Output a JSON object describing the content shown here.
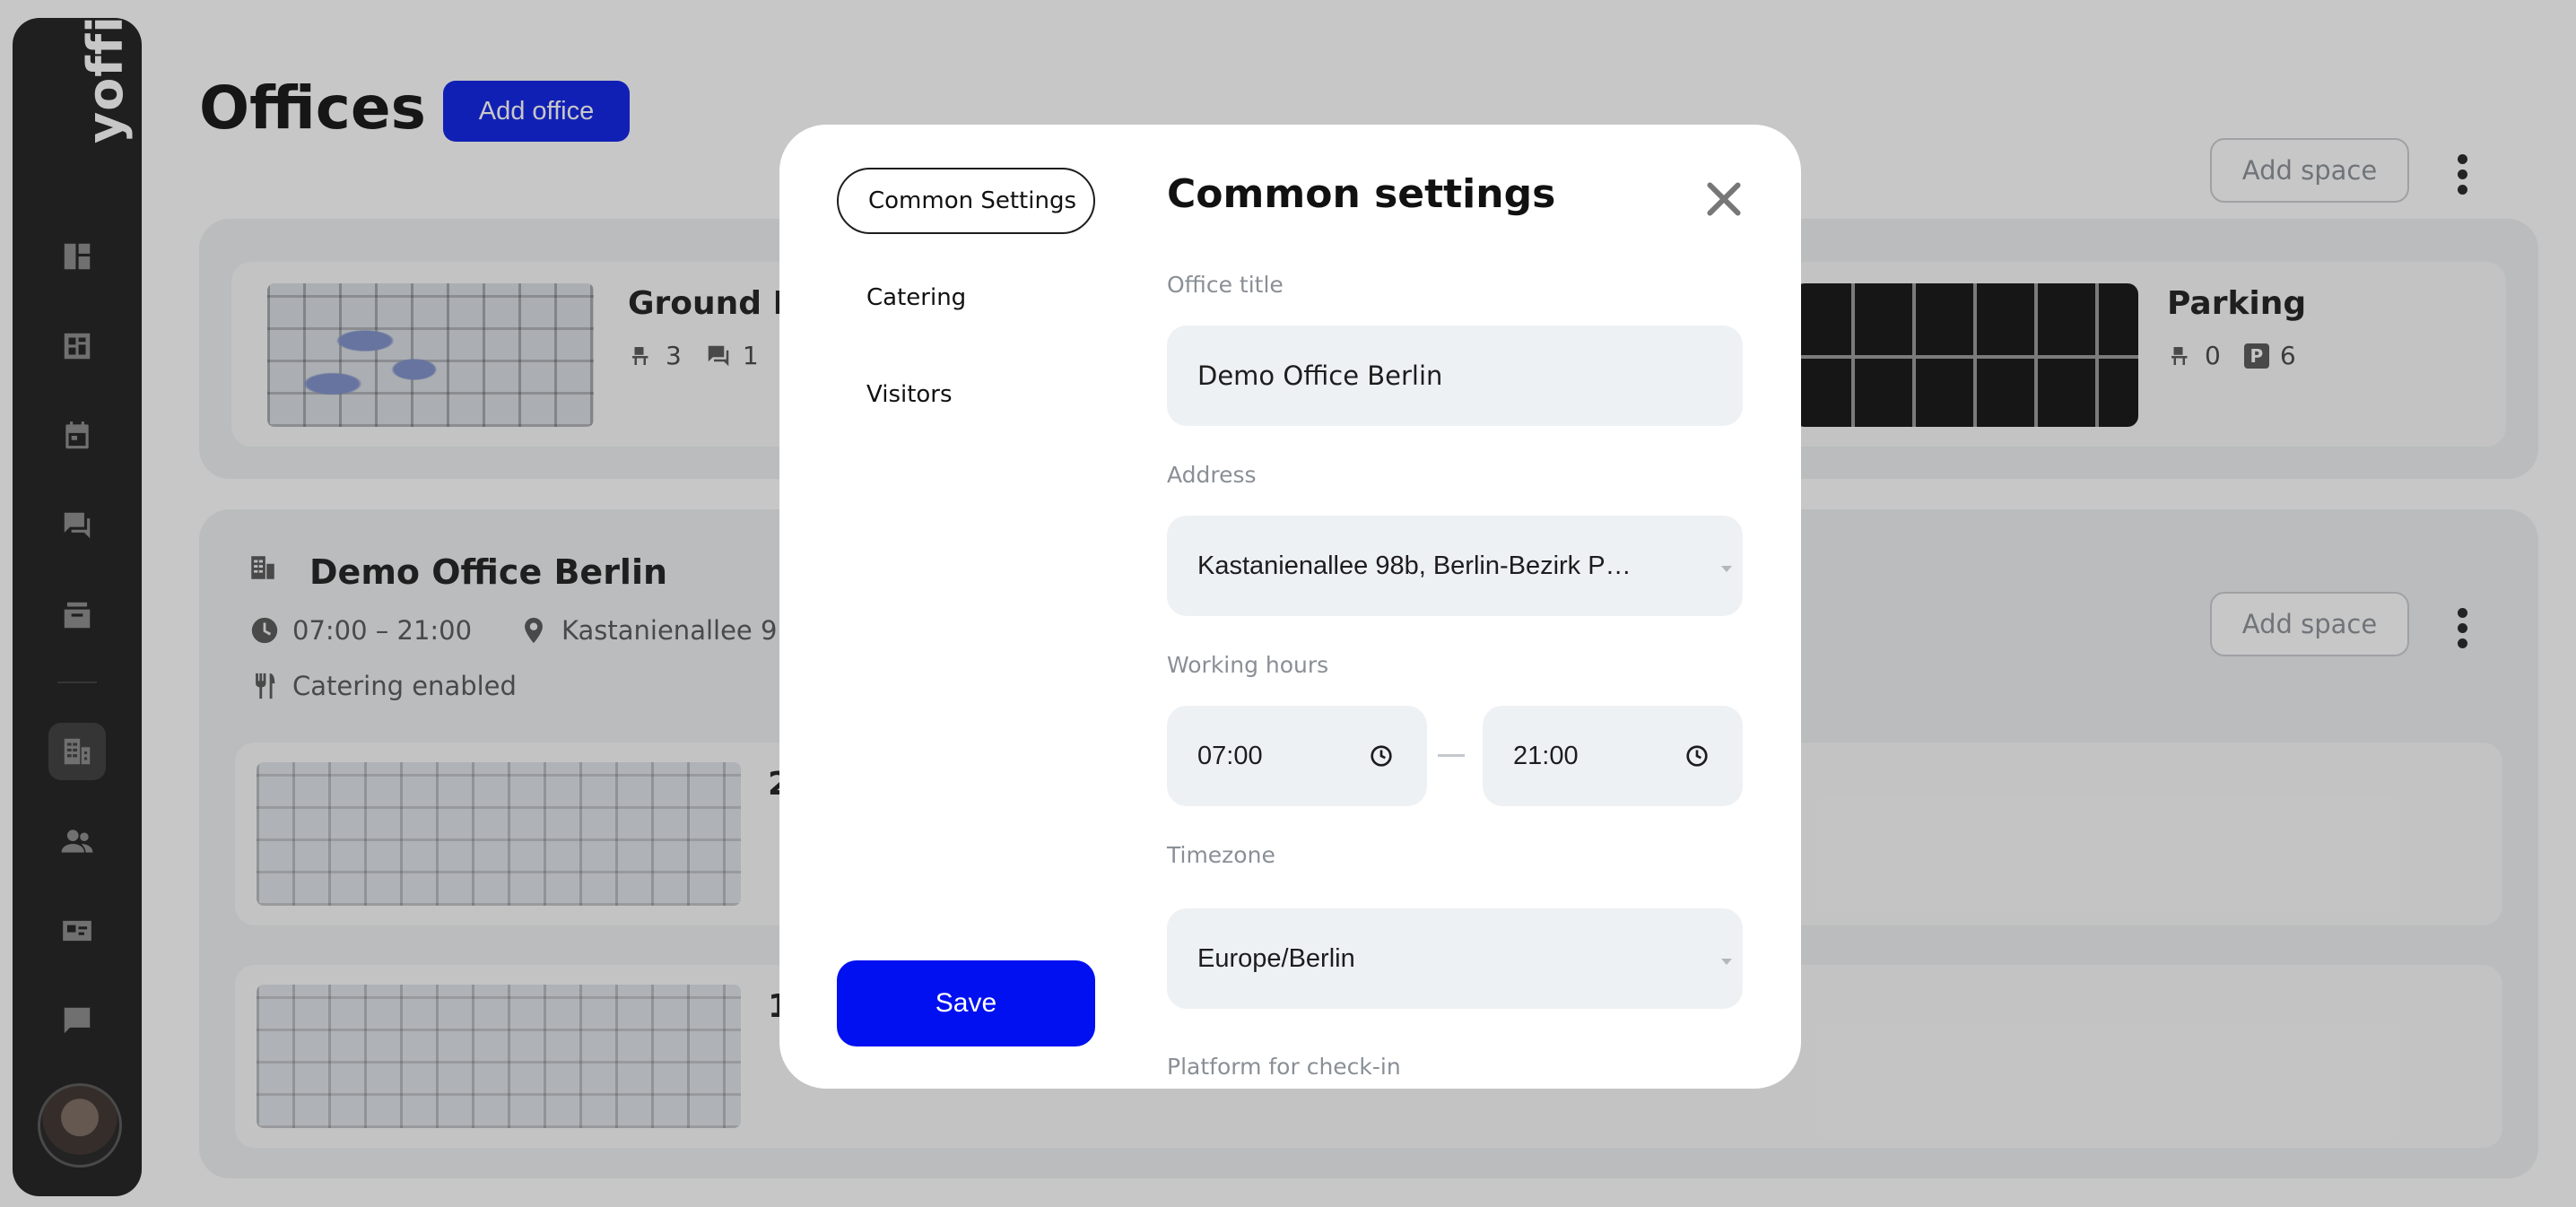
{
  "app": {
    "logo_text": "yoffix",
    "page_title": "Offices",
    "add_office_label": "Add office",
    "add_space_label": "Add space"
  },
  "sidebar": {
    "items": [
      {
        "icon": "dashboard-icon"
      },
      {
        "icon": "floorplan-icon"
      },
      {
        "icon": "calendar-icon"
      },
      {
        "icon": "chat-icon"
      },
      {
        "icon": "inbox-icon"
      },
      {
        "icon": "offices-icon",
        "active": true
      },
      {
        "icon": "users-icon"
      },
      {
        "icon": "id-card-icon"
      },
      {
        "icon": "messages-icon"
      }
    ],
    "avatar": "user-avatar"
  },
  "office_top": {
    "spaces": [
      {
        "title": "Ground Fl",
        "desks": "3",
        "rooms": "1"
      },
      {
        "title": "Parking",
        "desks": "0",
        "parking": "6",
        "parking_badge": "P"
      }
    ]
  },
  "office_berlin": {
    "name": "Demo Office Berlin",
    "hours": "07:00 – 21:00",
    "address_short": "Kastanienallee 9",
    "catering": "Catering enabled",
    "spaces": [
      {
        "title": "2"
      },
      {
        "title": "1"
      }
    ]
  },
  "modal": {
    "tabs": [
      {
        "label": "Common Settings",
        "active": true
      },
      {
        "label": "Catering"
      },
      {
        "label": "Visitors"
      }
    ],
    "save_label": "Save",
    "title": "Common settings",
    "fields": {
      "office_title_label": "Office title",
      "office_title_value": "Demo Office Berlin",
      "address_label": "Address",
      "address_value": "Kastanienallee 98b, Berlin-Bezirk P…",
      "working_hours_label": "Working hours",
      "start_time": "07:00",
      "end_time": "21:00",
      "timezone_label": "Timezone",
      "timezone_value": "Europe/Berlin",
      "platform_label": "Platform for check-in"
    }
  },
  "colors": {
    "primary": "#0a1ee6",
    "sidebar": "#1d1d1d",
    "field_bg": "#eef1f4",
    "label": "#8a8f96"
  }
}
